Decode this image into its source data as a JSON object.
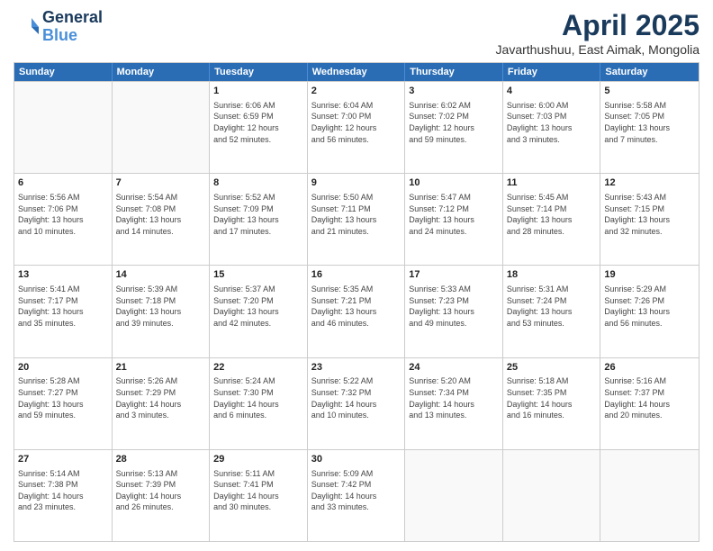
{
  "header": {
    "logo_general": "General",
    "logo_blue": "Blue",
    "month_year": "April 2025",
    "location": "Javarthushuu, East Aimak, Mongolia"
  },
  "days_of_week": [
    "Sunday",
    "Monday",
    "Tuesday",
    "Wednesday",
    "Thursday",
    "Friday",
    "Saturday"
  ],
  "weeks": [
    [
      {
        "day": "",
        "info": ""
      },
      {
        "day": "",
        "info": ""
      },
      {
        "day": "1",
        "info": "Sunrise: 6:06 AM\nSunset: 6:59 PM\nDaylight: 12 hours\nand 52 minutes."
      },
      {
        "day": "2",
        "info": "Sunrise: 6:04 AM\nSunset: 7:00 PM\nDaylight: 12 hours\nand 56 minutes."
      },
      {
        "day": "3",
        "info": "Sunrise: 6:02 AM\nSunset: 7:02 PM\nDaylight: 12 hours\nand 59 minutes."
      },
      {
        "day": "4",
        "info": "Sunrise: 6:00 AM\nSunset: 7:03 PM\nDaylight: 13 hours\nand 3 minutes."
      },
      {
        "day": "5",
        "info": "Sunrise: 5:58 AM\nSunset: 7:05 PM\nDaylight: 13 hours\nand 7 minutes."
      }
    ],
    [
      {
        "day": "6",
        "info": "Sunrise: 5:56 AM\nSunset: 7:06 PM\nDaylight: 13 hours\nand 10 minutes."
      },
      {
        "day": "7",
        "info": "Sunrise: 5:54 AM\nSunset: 7:08 PM\nDaylight: 13 hours\nand 14 minutes."
      },
      {
        "day": "8",
        "info": "Sunrise: 5:52 AM\nSunset: 7:09 PM\nDaylight: 13 hours\nand 17 minutes."
      },
      {
        "day": "9",
        "info": "Sunrise: 5:50 AM\nSunset: 7:11 PM\nDaylight: 13 hours\nand 21 minutes."
      },
      {
        "day": "10",
        "info": "Sunrise: 5:47 AM\nSunset: 7:12 PM\nDaylight: 13 hours\nand 24 minutes."
      },
      {
        "day": "11",
        "info": "Sunrise: 5:45 AM\nSunset: 7:14 PM\nDaylight: 13 hours\nand 28 minutes."
      },
      {
        "day": "12",
        "info": "Sunrise: 5:43 AM\nSunset: 7:15 PM\nDaylight: 13 hours\nand 32 minutes."
      }
    ],
    [
      {
        "day": "13",
        "info": "Sunrise: 5:41 AM\nSunset: 7:17 PM\nDaylight: 13 hours\nand 35 minutes."
      },
      {
        "day": "14",
        "info": "Sunrise: 5:39 AM\nSunset: 7:18 PM\nDaylight: 13 hours\nand 39 minutes."
      },
      {
        "day": "15",
        "info": "Sunrise: 5:37 AM\nSunset: 7:20 PM\nDaylight: 13 hours\nand 42 minutes."
      },
      {
        "day": "16",
        "info": "Sunrise: 5:35 AM\nSunset: 7:21 PM\nDaylight: 13 hours\nand 46 minutes."
      },
      {
        "day": "17",
        "info": "Sunrise: 5:33 AM\nSunset: 7:23 PM\nDaylight: 13 hours\nand 49 minutes."
      },
      {
        "day": "18",
        "info": "Sunrise: 5:31 AM\nSunset: 7:24 PM\nDaylight: 13 hours\nand 53 minutes."
      },
      {
        "day": "19",
        "info": "Sunrise: 5:29 AM\nSunset: 7:26 PM\nDaylight: 13 hours\nand 56 minutes."
      }
    ],
    [
      {
        "day": "20",
        "info": "Sunrise: 5:28 AM\nSunset: 7:27 PM\nDaylight: 13 hours\nand 59 minutes."
      },
      {
        "day": "21",
        "info": "Sunrise: 5:26 AM\nSunset: 7:29 PM\nDaylight: 14 hours\nand 3 minutes."
      },
      {
        "day": "22",
        "info": "Sunrise: 5:24 AM\nSunset: 7:30 PM\nDaylight: 14 hours\nand 6 minutes."
      },
      {
        "day": "23",
        "info": "Sunrise: 5:22 AM\nSunset: 7:32 PM\nDaylight: 14 hours\nand 10 minutes."
      },
      {
        "day": "24",
        "info": "Sunrise: 5:20 AM\nSunset: 7:34 PM\nDaylight: 14 hours\nand 13 minutes."
      },
      {
        "day": "25",
        "info": "Sunrise: 5:18 AM\nSunset: 7:35 PM\nDaylight: 14 hours\nand 16 minutes."
      },
      {
        "day": "26",
        "info": "Sunrise: 5:16 AM\nSunset: 7:37 PM\nDaylight: 14 hours\nand 20 minutes."
      }
    ],
    [
      {
        "day": "27",
        "info": "Sunrise: 5:14 AM\nSunset: 7:38 PM\nDaylight: 14 hours\nand 23 minutes."
      },
      {
        "day": "28",
        "info": "Sunrise: 5:13 AM\nSunset: 7:39 PM\nDaylight: 14 hours\nand 26 minutes."
      },
      {
        "day": "29",
        "info": "Sunrise: 5:11 AM\nSunset: 7:41 PM\nDaylight: 14 hours\nand 30 minutes."
      },
      {
        "day": "30",
        "info": "Sunrise: 5:09 AM\nSunset: 7:42 PM\nDaylight: 14 hours\nand 33 minutes."
      },
      {
        "day": "",
        "info": ""
      },
      {
        "day": "",
        "info": ""
      },
      {
        "day": "",
        "info": ""
      }
    ]
  ]
}
